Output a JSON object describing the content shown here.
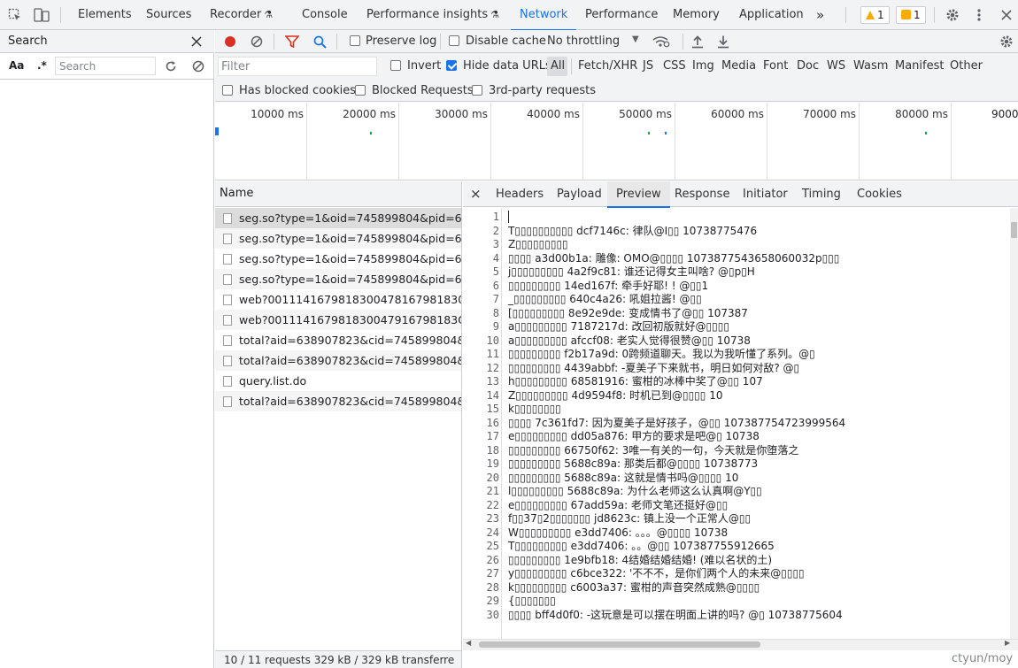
{
  "topbar": {
    "tabs": [
      "Elements",
      "Sources",
      "Recorder",
      "Console",
      "Performance insights",
      "Network",
      "Performance",
      "Memory",
      "Application"
    ],
    "more": "»",
    "warnings_count": "1",
    "issues_count": "1",
    "active_tab": "Network"
  },
  "search": {
    "title": "Search",
    "aa": "Aa",
    "regex": ".*",
    "placeholder": "Search"
  },
  "toolbar": {
    "preserve_log": "Preserve log",
    "disable_cache": "Disable cache",
    "throttling": "No throttling"
  },
  "filter": {
    "placeholder": "Filter",
    "invert": "Invert",
    "hide_data_urls": "Hide data URLs",
    "types": [
      "All",
      "Fetch/XHR",
      "JS",
      "CSS",
      "Img",
      "Media",
      "Font",
      "Doc",
      "WS",
      "Wasm",
      "Manifest",
      "Other"
    ],
    "has_blocked_cookies": "Has blocked cookies",
    "blocked_requests": "Blocked Requests",
    "third_party": "3rd-party requests"
  },
  "timeline": {
    "ticks": [
      "10000 ms",
      "20000 ms",
      "30000 ms",
      "40000 ms",
      "50000 ms",
      "60000 ms",
      "70000 ms",
      "80000 ms",
      "9000"
    ]
  },
  "requests": {
    "header": "Name",
    "rows": [
      "seg.so?type=1&oid=745899804&pid=6...",
      "seg.so?type=1&oid=745899804&pid=6...",
      "seg.so?type=1&oid=745899804&pid=6...",
      "seg.so?type=1&oid=745899804&pid=6...",
      "web?0011141679818300478167981830...",
      "web?001114167981830047916798183O...",
      "total?aid=638907823&cid=745899804&...",
      "total?aid=638907823&cid=745899804&...",
      "query.list.do",
      "total?aid=638907823&cid=745899804&..."
    ],
    "status": "10 / 11 requests   329 kB / 329 kB transferre"
  },
  "detail": {
    "close": "×",
    "tabs": [
      "Headers",
      "Payload",
      "Preview",
      "Response",
      "Initiator",
      "Timing",
      "Cookies"
    ],
    "active_tab": "Preview",
    "lines": [
      "",
      "T▯▯▯▯▯▯▯▯▯▯ dcf7146c: 律队@I▯▯ 10738775476",
      "Z▯▯▯▯▯▯▯▯▯",
      "▯▯▯▯ a3d00b1a: 雕像: OMO@▯▯▯▯ 1073877543658060032p▯▯▯",
      "j▯▯▯▯▯▯▯▯▯ 4a2f9c81: 谁还记得女主叫啥? @▯p▯H",
      "▯▯▯▯▯▯▯▯▯ 14ed167f: 牵手好耶! ! @▯▯1",
      "_▯▯▯▯▯▯▯▯▯ 640c4a26: 吼姐拉酱! @▯▯",
      "[▯▯▯▯▯▯▯▯▯ 8e92e9de: 变成情书了@▯▯ 107387",
      "a▯▯▯▯▯▯▯▯▯ 7187217d: 改回初版就好@▯▯▯▯",
      "a▯▯▯▯▯▯▯▯▯ afccf08: 老实人觉得很赞@▯▯ 10738",
      "▯▯▯▯▯▯▯▯▯ f2b17a9d: 0跨频道聊天。我以为我听懂了系列。@▯",
      "▯▯▯▯▯▯▯▯▯ 4439abbf: -夏美子下来就书，明日如何对敌? @▯",
      "h▯▯▯▯▯▯▯▯▯ 68581916: 蜜柑的冰棒中奖了@▯▯ 107",
      "Z▯▯▯▯▯▯▯▯▯ 4d9594f8: 时机已到@▯▯▯▯ 10",
      "k▯▯▯▯▯▯▯▯",
      "▯▯▯▯ 7c361fd7: 因为夏美子是好孩子，@▯▯ 107387754723999564",
      "e▯▯▯▯▯▯▯▯▯ dd05a876: 甲方的要求是吧@▯ 10738",
      "▯▯▯▯▯▯▯▯▯ 66750f62: 3唯一有关的一句，今天就是你堕落之",
      "▯▯▯▯▯▯▯▯▯ 5688c89a: 那类后都@▯▯▯▯ 10738773",
      "▯▯▯▯▯▯▯▯▯ 5688c89a: 这就是情书吗@▯▯▯▯ 10",
      "l▯▯▯▯▯▯▯▯▯ 5688c89a: 为什么老师这么认真啊@Y▯▯",
      "e▯▯▯▯▯▯▯▯▯ 67add59a: 老师文笔还挺好@▯▯",
      "f▯▯37▯2▯▯▯▯▯▯▯ jd8623c: 镇上没一个正常人@▯▯",
      "W▯▯▯▯▯▯▯▯▯ e3dd7406:   。。。@▯▯▯▯ 10738",
      "T▯▯▯▯▯▯▯▯▯ e3dd7406: 。。@▯▯ 107387755912665",
      "▯▯▯▯▯▯▯▯▯ 1e9bfb18: 4结婚结婚结婚! (难以名状的土)",
      "y▯▯▯▯▯▯▯▯▯ c6bce322: '不不不，是你们两个人的未来@▯▯▯▯",
      "k▯▯▯▯▯▯▯▯▯ c6003a37: 蜜柑的声音突然成熟@▯▯▯▯",
      "{▯▯▯▯▯▯▯",
      "▯▯▯▯ bff4d0f0: -这玩意是可以摆在明面上讲的吗? @▯ 10738775604"
    ]
  },
  "watermark": "ctyun/moy"
}
